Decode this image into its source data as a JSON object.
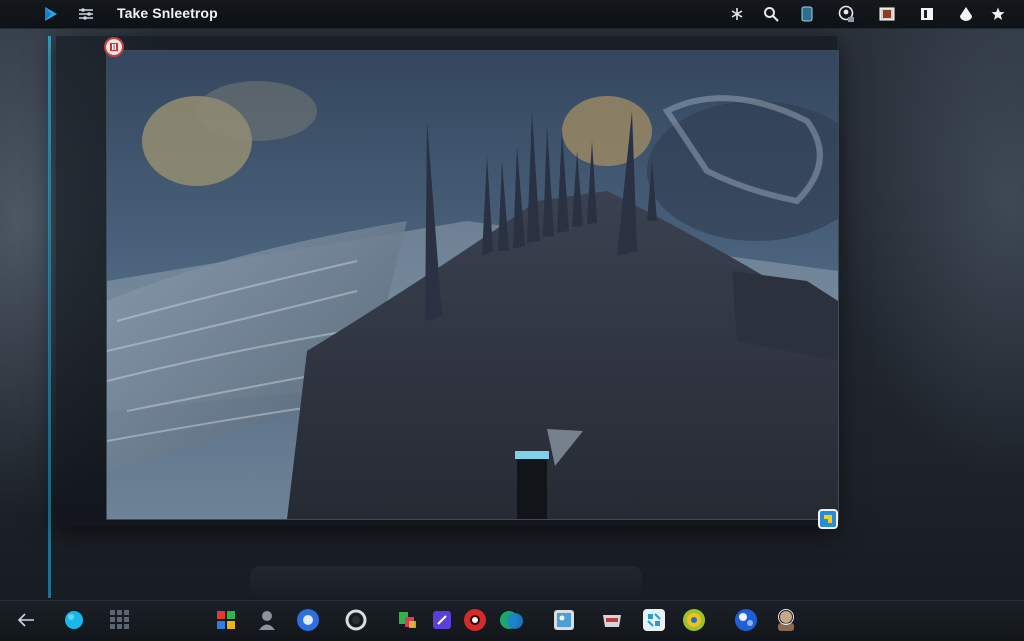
{
  "app": {
    "title": "Take Snleetrop"
  },
  "topbar": {
    "left_icons": [
      "play-logo-icon",
      "sliders-icon"
    ],
    "right_icons": [
      "asterisk-icon",
      "search-icon",
      "device-icon",
      "account-circle-icon",
      "photo-icon",
      "panel-icon",
      "drop-icon",
      "star-icon"
    ]
  },
  "canvas": {
    "content": "fantasy-landscape-image",
    "corner_handles": [
      "top-left-handle-icon",
      "bottom-right-handle-icon"
    ]
  },
  "taskbar": {
    "items": [
      "back-arrow-icon",
      "cyan-orb-icon",
      "app-grid-icon",
      "windows-tiles-icon",
      "person-icon",
      "blue-circle-app-icon",
      "ring-app-icon",
      "shapes-app-icon",
      "purple-app-icon",
      "red-record-icon",
      "green-blue-app-icon",
      "image-editor-icon",
      "tray-app-icon",
      "puzzle-app-icon",
      "yellow-green-app-icon",
      "blue-dots-app-icon",
      "user-avatar-icon"
    ]
  },
  "colors": {
    "accent": "#3fb6d8",
    "topbar": "#12161b",
    "taskbar": "#161a20"
  }
}
